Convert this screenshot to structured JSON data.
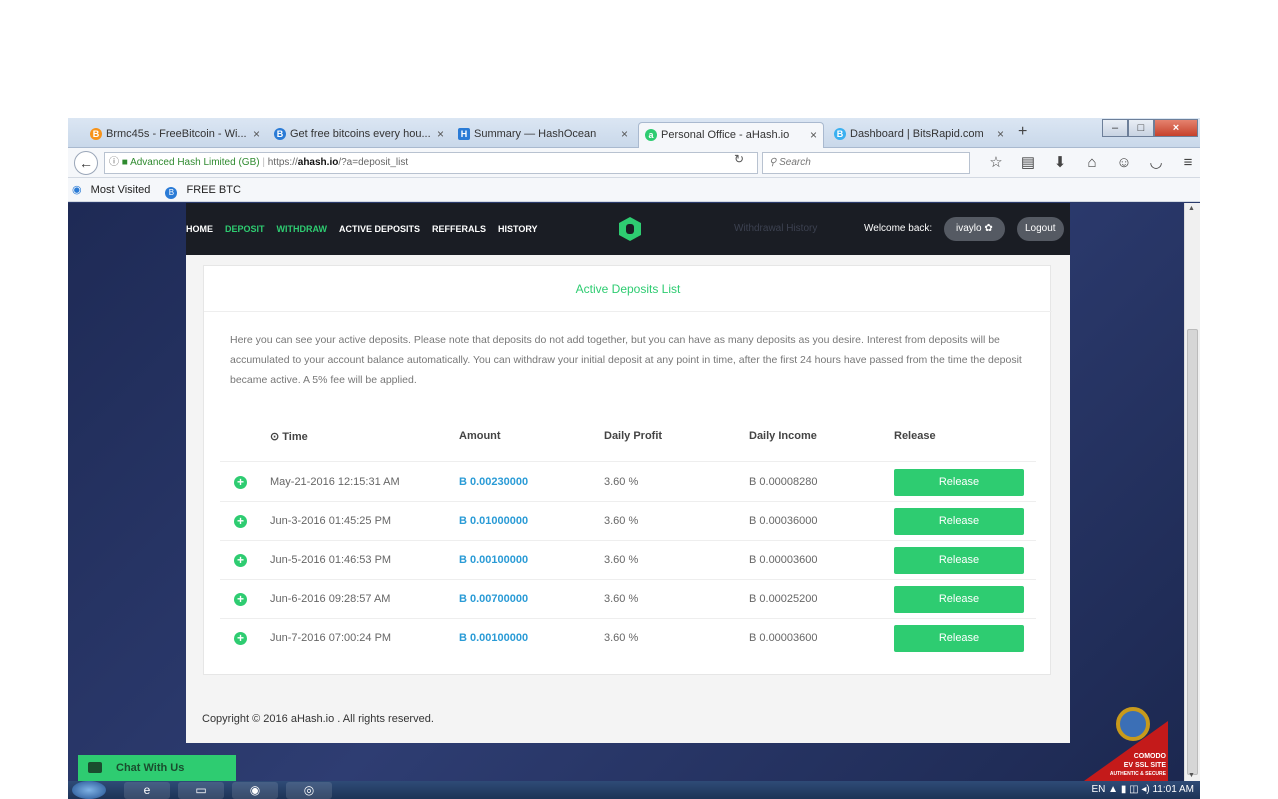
{
  "browser": {
    "tabs": [
      {
        "label": "Brmc45s - FreeBitcoin - Wi...",
        "icon": "bitcoin-orange-icon",
        "color": "#f7931a",
        "glyph": "B"
      },
      {
        "label": "Get free bitcoins every hou...",
        "icon": "bitcoin-blue-icon",
        "color": "#2a7bd6",
        "glyph": "B"
      },
      {
        "label": "Summary — HashOcean",
        "icon": "hashocean-icon",
        "color": "#2a7bd6",
        "glyph": "H"
      },
      {
        "label": "Personal Office - aHash.io",
        "icon": "ahash-icon",
        "color": "#2ecc71",
        "glyph": "a"
      },
      {
        "label": "Dashboard | BitsRapid.com",
        "icon": "bitsrapid-icon",
        "color": "#3ab0f0",
        "glyph": "B"
      }
    ],
    "new_tab": "+",
    "url_ev": "Advanced Hash Limited (GB)",
    "url_prefix": "https://",
    "url_domain": "ahash.io",
    "url_path": "/?a=deposit_list",
    "search_placeholder": "Search",
    "bookmarks": [
      "Most Visited",
      "FREE BTC"
    ]
  },
  "site": {
    "nav": [
      "HOME",
      "DEPOSIT",
      "WITHDRAW",
      "ACTIVE DEPOSITS",
      "REFFERALS",
      "HISTORY"
    ],
    "withdrawal_history": "Withdrawal History",
    "welcome": "Welcome back:",
    "username": "ivaylo ✿",
    "logout": "Logout"
  },
  "card": {
    "title": "Active Deposits List",
    "intro": "Here you can see your active deposits. Please note that deposits do not add together, but you can have as many deposits as you desire. Interest from deposits will be accumulated to your account balance automatically. You can withdraw your initial deposit at any point in time, after the first 24 hours have passed from the time the deposit became active. A 5% fee will be applied."
  },
  "table": {
    "headers": {
      "time": "⊙ Time",
      "amount": "Amount",
      "daily_profit": "Daily Profit",
      "daily_income": "Daily Income",
      "release": "Release"
    },
    "rows": [
      {
        "time": "May-21-2016 12:15:31 AM",
        "amount": "B 0.00230000",
        "profit": "3.60 %",
        "income": "B 0.00008280",
        "release": "Release"
      },
      {
        "time": "Jun-3-2016 01:45:25 PM",
        "amount": "B 0.01000000",
        "profit": "3.60 %",
        "income": "B 0.00036000",
        "release": "Release"
      },
      {
        "time": "Jun-5-2016 01:46:53 PM",
        "amount": "B 0.00100000",
        "profit": "3.60 %",
        "income": "B 0.00003600",
        "release": "Release"
      },
      {
        "time": "Jun-6-2016 09:28:57 AM",
        "amount": "B 0.00700000",
        "profit": "3.60 %",
        "income": "B 0.00025200",
        "release": "Release"
      },
      {
        "time": "Jun-7-2016 07:00:24 PM",
        "amount": "B 0.00100000",
        "profit": "3.60 %",
        "income": "B 0.00003600",
        "release": "Release"
      }
    ]
  },
  "footer": {
    "copyright": "Copyright © 2016 aHash.io . All rights reserved."
  },
  "chat": {
    "label": "Chat With Us"
  },
  "comodo": {
    "line1": "COMODO",
    "line2": "EV SSL SITE",
    "line3": "AUTHENTIC & SECURE"
  },
  "taskbar": {
    "lang": "EN",
    "time": "11:01 AM"
  },
  "colors": {
    "accent": "#2ecc71",
    "amount": "#2a9bd6",
    "nav_bg": "#1a1d24"
  }
}
